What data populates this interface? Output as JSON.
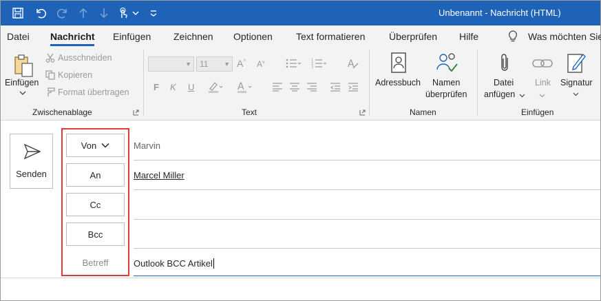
{
  "window": {
    "title": "Unbenannt  -  Nachricht (HTML)"
  },
  "menu": {
    "tabs": [
      "Datei",
      "Nachricht",
      "Einfügen",
      "Zeichnen",
      "Optionen",
      "Text formatieren",
      "Überprüfen",
      "Hilfe"
    ],
    "active_tab": "Nachricht",
    "tell_me": "Was möchten Sie"
  },
  "ribbon": {
    "clipboard": {
      "paste": "Einfügen",
      "cut": "Ausschneiden",
      "copy": "Kopieren",
      "format_painter": "Format übertragen",
      "label": "Zwischenablage"
    },
    "text": {
      "font_size": "11",
      "bold": "F",
      "italic": "K",
      "underline": "U",
      "label": "Text"
    },
    "names": {
      "address_book": "Adressbuch",
      "check_names_line1": "Namen",
      "check_names_line2": "überprüfen",
      "label": "Namen"
    },
    "insert": {
      "attach_line1": "Datei",
      "attach_line2": "anfügen",
      "link": "Link",
      "signature": "Signatur",
      "label": "Einfügen"
    }
  },
  "compose": {
    "send": "Senden",
    "from_button": "Von",
    "from_value": "Marvin",
    "to_button": "An",
    "to_value": "Marcel Miller",
    "cc_button": "Cc",
    "bcc_button": "Bcc",
    "subject_label": "Betreff",
    "subject_value": "Outlook BCC Artikel"
  },
  "colors": {
    "titlebar": "#1e63b8",
    "highlight": "#e53935",
    "ribbon_bg": "#f3f3f3"
  }
}
